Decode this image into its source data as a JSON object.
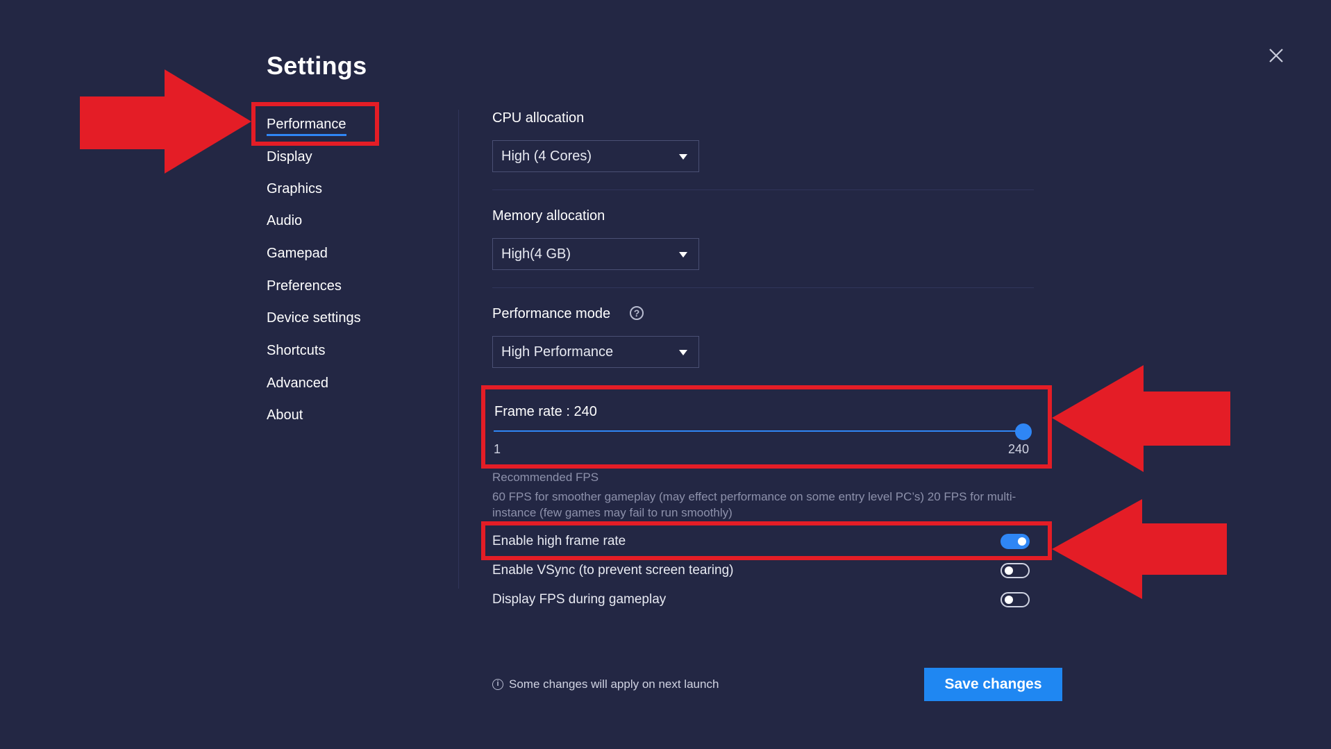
{
  "page": {
    "title": "Settings"
  },
  "colors": {
    "background": "#232744",
    "accent": "#2f86f5",
    "annotation": "#e41d26",
    "button": "#1f87f2"
  },
  "sidebar": {
    "items": [
      {
        "label": "Performance",
        "active": true
      },
      {
        "label": "Display"
      },
      {
        "label": "Graphics"
      },
      {
        "label": "Audio"
      },
      {
        "label": "Gamepad"
      },
      {
        "label": "Preferences"
      },
      {
        "label": "Device settings"
      },
      {
        "label": "Shortcuts"
      },
      {
        "label": "Advanced"
      },
      {
        "label": "About"
      }
    ]
  },
  "performance": {
    "cpu": {
      "label": "CPU allocation",
      "value": "High (4 Cores)"
    },
    "memory": {
      "label": "Memory allocation",
      "value": "High(4 GB)"
    },
    "mode": {
      "label": "Performance mode",
      "help": "?",
      "value": "High Performance"
    },
    "frame_rate": {
      "label": "Frame rate : 240",
      "min": "1",
      "max": "240",
      "value": 240
    },
    "recommended": {
      "title": "Recommended FPS",
      "text": "60 FPS for smoother gameplay (may effect performance on some entry level PC’s) 20 FPS for multi-instance (few games may fail to run smoothly)"
    },
    "toggles": [
      {
        "label": "Enable high frame rate",
        "on": true
      },
      {
        "label": "Enable VSync (to prevent screen tearing)",
        "on": false
      },
      {
        "label": "Display FPS during gameplay",
        "on": false
      }
    ]
  },
  "footer": {
    "note": "Some changes will apply on next launch",
    "save": "Save changes"
  },
  "icons": {
    "close": "close-icon",
    "info": "info-icon",
    "help": "help-icon",
    "caret": "chevron-down-icon"
  }
}
